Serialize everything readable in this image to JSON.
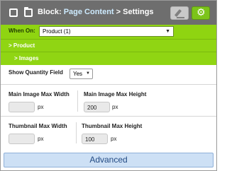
{
  "header": {
    "title_prefix": "Block:",
    "title_link": "Page Content",
    "title_suffix": "> Settings",
    "icons": [
      "checkbox-icon",
      "folder-icon",
      "pencil-icon",
      "gear-icon"
    ],
    "gear_glyph": "⚙"
  },
  "when_on": {
    "label": "When On:",
    "value": "Product (1)",
    "arrow": "▼"
  },
  "breadcrumbs": {
    "product": "> Product",
    "images": "> Images"
  },
  "quantity": {
    "label": "Show Quantity Field",
    "value": "Yes",
    "arrow": "▼"
  },
  "main_image": {
    "width_label": "Main Image Max Width",
    "width_value": "",
    "height_label": "Main Image Max Height",
    "height_value": "200",
    "unit": "px"
  },
  "thumbnail": {
    "width_label": "Thumbnail Max Width",
    "width_value": "",
    "height_label": "Thumbnail Max Height",
    "height_value": "100",
    "unit": "px"
  },
  "footer": {
    "advanced_label": "Advanced"
  },
  "colors": {
    "header_bg": "#6e6e6e",
    "green_bar": "#8fd411",
    "gear_button": "#7cc41a",
    "advanced_bg": "#cde0f5",
    "advanced_text": "#244b84",
    "title_link": "#cdebff"
  }
}
